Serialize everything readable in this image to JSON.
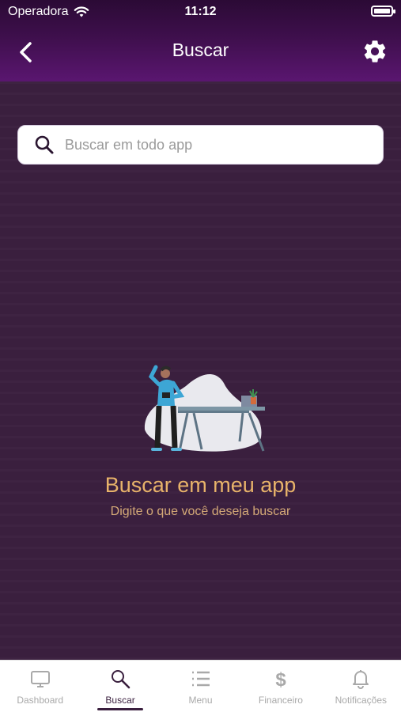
{
  "status_bar": {
    "carrier": "Operadora",
    "time": "11:12"
  },
  "header": {
    "title": "Buscar",
    "back_icon": "chevron-left-icon",
    "settings_icon": "gear-icon"
  },
  "search": {
    "placeholder": "Buscar em todo app",
    "value": ""
  },
  "empty_state": {
    "title": "Buscar em meu app",
    "subtitle": "Digite o que você deseja buscar"
  },
  "tabs": [
    {
      "label": "Dashboard",
      "icon": "monitor-icon",
      "active": false
    },
    {
      "label": "Buscar",
      "icon": "search-icon",
      "active": true
    },
    {
      "label": "Menu",
      "icon": "list-icon",
      "active": false
    },
    {
      "label": "Financeiro",
      "icon": "dollar-icon",
      "active": false
    },
    {
      "label": "Notificações",
      "icon": "bell-icon",
      "active": false
    }
  ],
  "colors": {
    "background": "#3a1f3e",
    "header_gradient_end": "#5a1670",
    "accent_text": "#e8b36a",
    "tab_active": "#3a1f3e",
    "tab_inactive": "#a9a9a9"
  }
}
